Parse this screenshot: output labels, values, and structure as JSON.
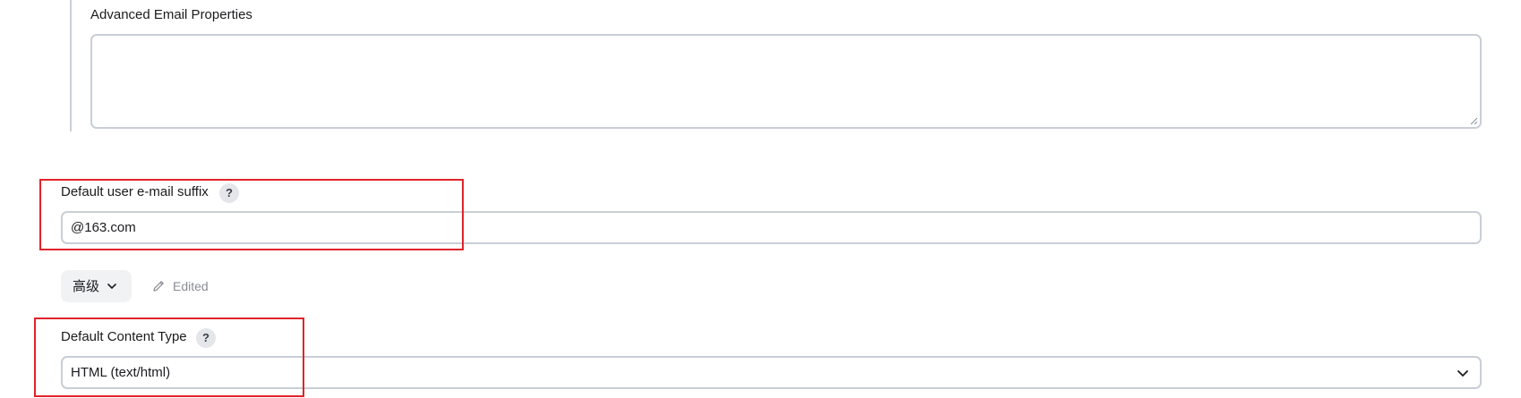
{
  "advanced_email_properties": {
    "label": "Advanced Email Properties",
    "value": ""
  },
  "default_email_suffix": {
    "label": "Default user e-mail suffix",
    "help": "?",
    "value": "@163.com"
  },
  "advanced_button": {
    "label": "高级"
  },
  "edited_indicator": {
    "label": "Edited"
  },
  "default_content_type": {
    "label": "Default Content Type",
    "help": "?",
    "selected": "HTML (text/html)"
  },
  "colors": {
    "highlight": "#e0242a",
    "border": "#c9ced6",
    "muted_text": "#8a8d94",
    "button_bg": "#f1f2f4"
  },
  "icons": {
    "help": "question-mark-icon",
    "dropdown": "chevron-down-icon",
    "edited": "pencil-icon",
    "resize": "resize-grip-icon"
  }
}
